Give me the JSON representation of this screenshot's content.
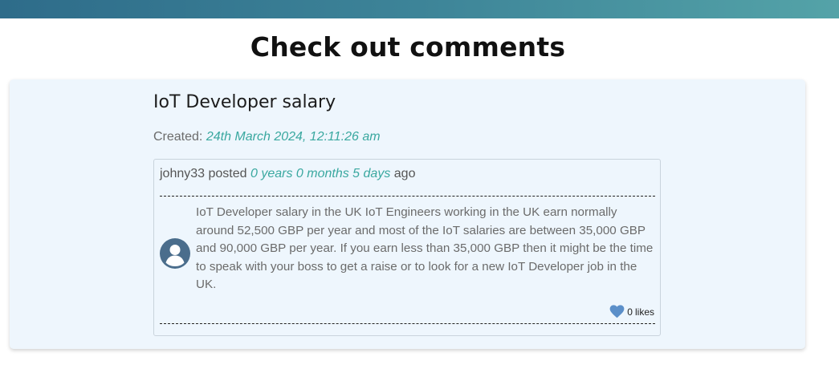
{
  "page": {
    "title": "Check out comments"
  },
  "post": {
    "title": "IoT Developer salary",
    "created_label": "Created:",
    "created_date": "24th March 2024, 12:11:26 am"
  },
  "comment": {
    "author": "johny33",
    "posted_word": "posted",
    "elapsed": "0 years 0 months 5 days",
    "ago_word": "ago",
    "body": "IoT Developer salary in the UK IoT Engineers working in the UK earn normally around 52,500 GBP per year and most of the IoT salaries are between 35,000 GBP and 90,000 GBP per year. If you earn less than 35,000 GBP then it might be the time to speak with your boss to get a raise or to look for a new IoT Developer job in the UK.",
    "likes_count": "0",
    "likes_word": "likes"
  },
  "icons": {
    "avatar": "user-avatar-icon",
    "like": "heart-icon"
  },
  "colors": {
    "header_gradient_start": "#2e6c8a",
    "header_gradient_end": "#54a3a8",
    "card_background": "#eef6fd",
    "accent_teal": "#3aa8a0",
    "avatar_blue": "#4a6d8c",
    "heart_blue": "#5b8fc9"
  }
}
